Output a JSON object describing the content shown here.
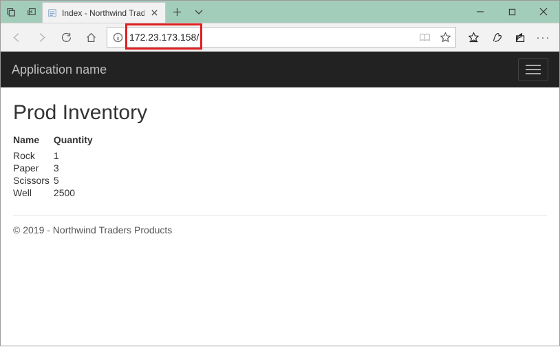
{
  "window": {
    "tab_title": "Index - Northwind Traders"
  },
  "toolbar": {
    "url": "172.23.173.158/"
  },
  "navbar": {
    "brand": "Application name"
  },
  "page": {
    "heading": "Prod Inventory"
  },
  "table": {
    "headers": {
      "c0": "Name",
      "c1": "Quantity"
    },
    "rows": [
      {
        "c0": "Rock",
        "c1": "1"
      },
      {
        "c0": "Paper",
        "c1": "3"
      },
      {
        "c0": "Scissors",
        "c1": "5"
      },
      {
        "c0": "Well",
        "c1": "2500"
      }
    ]
  },
  "footer": {
    "text": "© 2019 - Northwind Traders Products"
  }
}
